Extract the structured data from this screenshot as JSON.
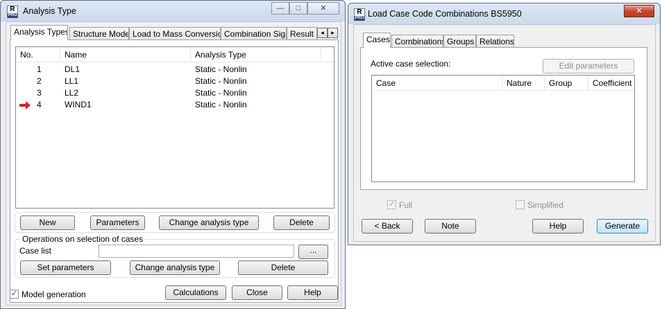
{
  "left_window": {
    "title": "Analysis Type",
    "icon_top": "R",
    "icon_bottom": "PRO",
    "caption_buttons": {
      "minimize": "—",
      "maximize": "□",
      "close": "✕"
    },
    "tabs": [
      {
        "label": "Analysis Types",
        "active": true
      },
      {
        "label": "Structure Model",
        "active": false
      },
      {
        "label": "Load to Mass Conversion",
        "active": false
      },
      {
        "label": "Combination Sign",
        "active": false
      },
      {
        "label": "Result F",
        "active": false
      }
    ],
    "tab_scroll": {
      "left": "◂",
      "right": "▸"
    },
    "list": {
      "columns": [
        "No.",
        "Name",
        "Analysis Type"
      ],
      "rows": [
        {
          "no": "1",
          "name": "DL1",
          "type": "Static - Nonlin",
          "current": false
        },
        {
          "no": "2",
          "name": "LL1",
          "type": "Static - Nonlin",
          "current": false
        },
        {
          "no": "3",
          "name": "LL2",
          "type": "Static - Nonlin",
          "current": false
        },
        {
          "no": "4",
          "name": "WIND1",
          "type": "Static - Nonlin",
          "current": true
        }
      ]
    },
    "buttons_row1": {
      "new": "New",
      "parameters": "Parameters",
      "change": "Change analysis type",
      "delete": "Delete"
    },
    "operations": {
      "legend": "Operations on selection of cases",
      "case_list_label": "Case list",
      "case_list_value": "",
      "browse": "...",
      "set_parameters": "Set parameters",
      "change": "Change analysis type",
      "delete": "Delete"
    },
    "model_generation": {
      "label": "Model generation",
      "checked": true,
      "mark": "✓"
    },
    "footer": {
      "calculations": "Calculations",
      "close": "Close",
      "help": "Help"
    }
  },
  "right_window": {
    "title": "Load Case Code Combinations BS5950",
    "icon_top": "R",
    "icon_bottom": "PRO",
    "caption_buttons": {
      "close": "✕"
    },
    "tabs": [
      {
        "label": "Cases",
        "active": true
      },
      {
        "label": "Combinations",
        "active": false
      },
      {
        "label": "Groups",
        "active": false
      },
      {
        "label": "Relations",
        "active": false
      }
    ],
    "active_case_label": "Active case selection:",
    "edit_parameters": "Edit parameters",
    "table_columns": [
      "Case",
      "Nature",
      "Group",
      "Coefficient"
    ],
    "full": {
      "label": "Full",
      "checked": true,
      "mark": "✓"
    },
    "simplified": {
      "label": "Simplified",
      "checked": false,
      "mark": ""
    },
    "footer": {
      "back": "< Back",
      "note": "Note",
      "help": "Help",
      "generate": "Generate"
    }
  },
  "colors": {
    "arrow": "#e0201b",
    "accent": "#3c7fb1"
  }
}
